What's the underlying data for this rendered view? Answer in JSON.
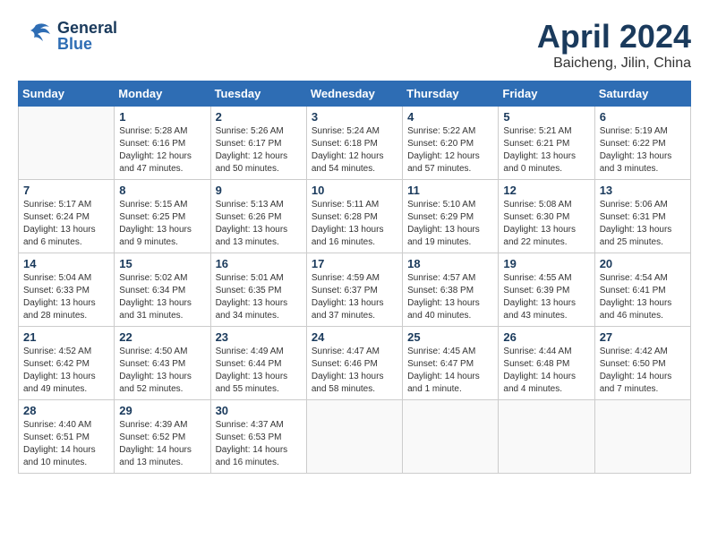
{
  "header": {
    "logo_general": "General",
    "logo_blue": "Blue",
    "month_title": "April 2024",
    "location": "Baicheng, Jilin, China"
  },
  "weekdays": [
    "Sunday",
    "Monday",
    "Tuesday",
    "Wednesday",
    "Thursday",
    "Friday",
    "Saturday"
  ],
  "weeks": [
    [
      {
        "day": "",
        "info": ""
      },
      {
        "day": "1",
        "info": "Sunrise: 5:28 AM\nSunset: 6:16 PM\nDaylight: 12 hours\nand 47 minutes."
      },
      {
        "day": "2",
        "info": "Sunrise: 5:26 AM\nSunset: 6:17 PM\nDaylight: 12 hours\nand 50 minutes."
      },
      {
        "day": "3",
        "info": "Sunrise: 5:24 AM\nSunset: 6:18 PM\nDaylight: 12 hours\nand 54 minutes."
      },
      {
        "day": "4",
        "info": "Sunrise: 5:22 AM\nSunset: 6:20 PM\nDaylight: 12 hours\nand 57 minutes."
      },
      {
        "day": "5",
        "info": "Sunrise: 5:21 AM\nSunset: 6:21 PM\nDaylight: 13 hours\nand 0 minutes."
      },
      {
        "day": "6",
        "info": "Sunrise: 5:19 AM\nSunset: 6:22 PM\nDaylight: 13 hours\nand 3 minutes."
      }
    ],
    [
      {
        "day": "7",
        "info": "Sunrise: 5:17 AM\nSunset: 6:24 PM\nDaylight: 13 hours\nand 6 minutes."
      },
      {
        "day": "8",
        "info": "Sunrise: 5:15 AM\nSunset: 6:25 PM\nDaylight: 13 hours\nand 9 minutes."
      },
      {
        "day": "9",
        "info": "Sunrise: 5:13 AM\nSunset: 6:26 PM\nDaylight: 13 hours\nand 13 minutes."
      },
      {
        "day": "10",
        "info": "Sunrise: 5:11 AM\nSunset: 6:28 PM\nDaylight: 13 hours\nand 16 minutes."
      },
      {
        "day": "11",
        "info": "Sunrise: 5:10 AM\nSunset: 6:29 PM\nDaylight: 13 hours\nand 19 minutes."
      },
      {
        "day": "12",
        "info": "Sunrise: 5:08 AM\nSunset: 6:30 PM\nDaylight: 13 hours\nand 22 minutes."
      },
      {
        "day": "13",
        "info": "Sunrise: 5:06 AM\nSunset: 6:31 PM\nDaylight: 13 hours\nand 25 minutes."
      }
    ],
    [
      {
        "day": "14",
        "info": "Sunrise: 5:04 AM\nSunset: 6:33 PM\nDaylight: 13 hours\nand 28 minutes."
      },
      {
        "day": "15",
        "info": "Sunrise: 5:02 AM\nSunset: 6:34 PM\nDaylight: 13 hours\nand 31 minutes."
      },
      {
        "day": "16",
        "info": "Sunrise: 5:01 AM\nSunset: 6:35 PM\nDaylight: 13 hours\nand 34 minutes."
      },
      {
        "day": "17",
        "info": "Sunrise: 4:59 AM\nSunset: 6:37 PM\nDaylight: 13 hours\nand 37 minutes."
      },
      {
        "day": "18",
        "info": "Sunrise: 4:57 AM\nSunset: 6:38 PM\nDaylight: 13 hours\nand 40 minutes."
      },
      {
        "day": "19",
        "info": "Sunrise: 4:55 AM\nSunset: 6:39 PM\nDaylight: 13 hours\nand 43 minutes."
      },
      {
        "day": "20",
        "info": "Sunrise: 4:54 AM\nSunset: 6:41 PM\nDaylight: 13 hours\nand 46 minutes."
      }
    ],
    [
      {
        "day": "21",
        "info": "Sunrise: 4:52 AM\nSunset: 6:42 PM\nDaylight: 13 hours\nand 49 minutes."
      },
      {
        "day": "22",
        "info": "Sunrise: 4:50 AM\nSunset: 6:43 PM\nDaylight: 13 hours\nand 52 minutes."
      },
      {
        "day": "23",
        "info": "Sunrise: 4:49 AM\nSunset: 6:44 PM\nDaylight: 13 hours\nand 55 minutes."
      },
      {
        "day": "24",
        "info": "Sunrise: 4:47 AM\nSunset: 6:46 PM\nDaylight: 13 hours\nand 58 minutes."
      },
      {
        "day": "25",
        "info": "Sunrise: 4:45 AM\nSunset: 6:47 PM\nDaylight: 14 hours\nand 1 minute."
      },
      {
        "day": "26",
        "info": "Sunrise: 4:44 AM\nSunset: 6:48 PM\nDaylight: 14 hours\nand 4 minutes."
      },
      {
        "day": "27",
        "info": "Sunrise: 4:42 AM\nSunset: 6:50 PM\nDaylight: 14 hours\nand 7 minutes."
      }
    ],
    [
      {
        "day": "28",
        "info": "Sunrise: 4:40 AM\nSunset: 6:51 PM\nDaylight: 14 hours\nand 10 minutes."
      },
      {
        "day": "29",
        "info": "Sunrise: 4:39 AM\nSunset: 6:52 PM\nDaylight: 14 hours\nand 13 minutes."
      },
      {
        "day": "30",
        "info": "Sunrise: 4:37 AM\nSunset: 6:53 PM\nDaylight: 14 hours\nand 16 minutes."
      },
      {
        "day": "",
        "info": ""
      },
      {
        "day": "",
        "info": ""
      },
      {
        "day": "",
        "info": ""
      },
      {
        "day": "",
        "info": ""
      }
    ]
  ]
}
